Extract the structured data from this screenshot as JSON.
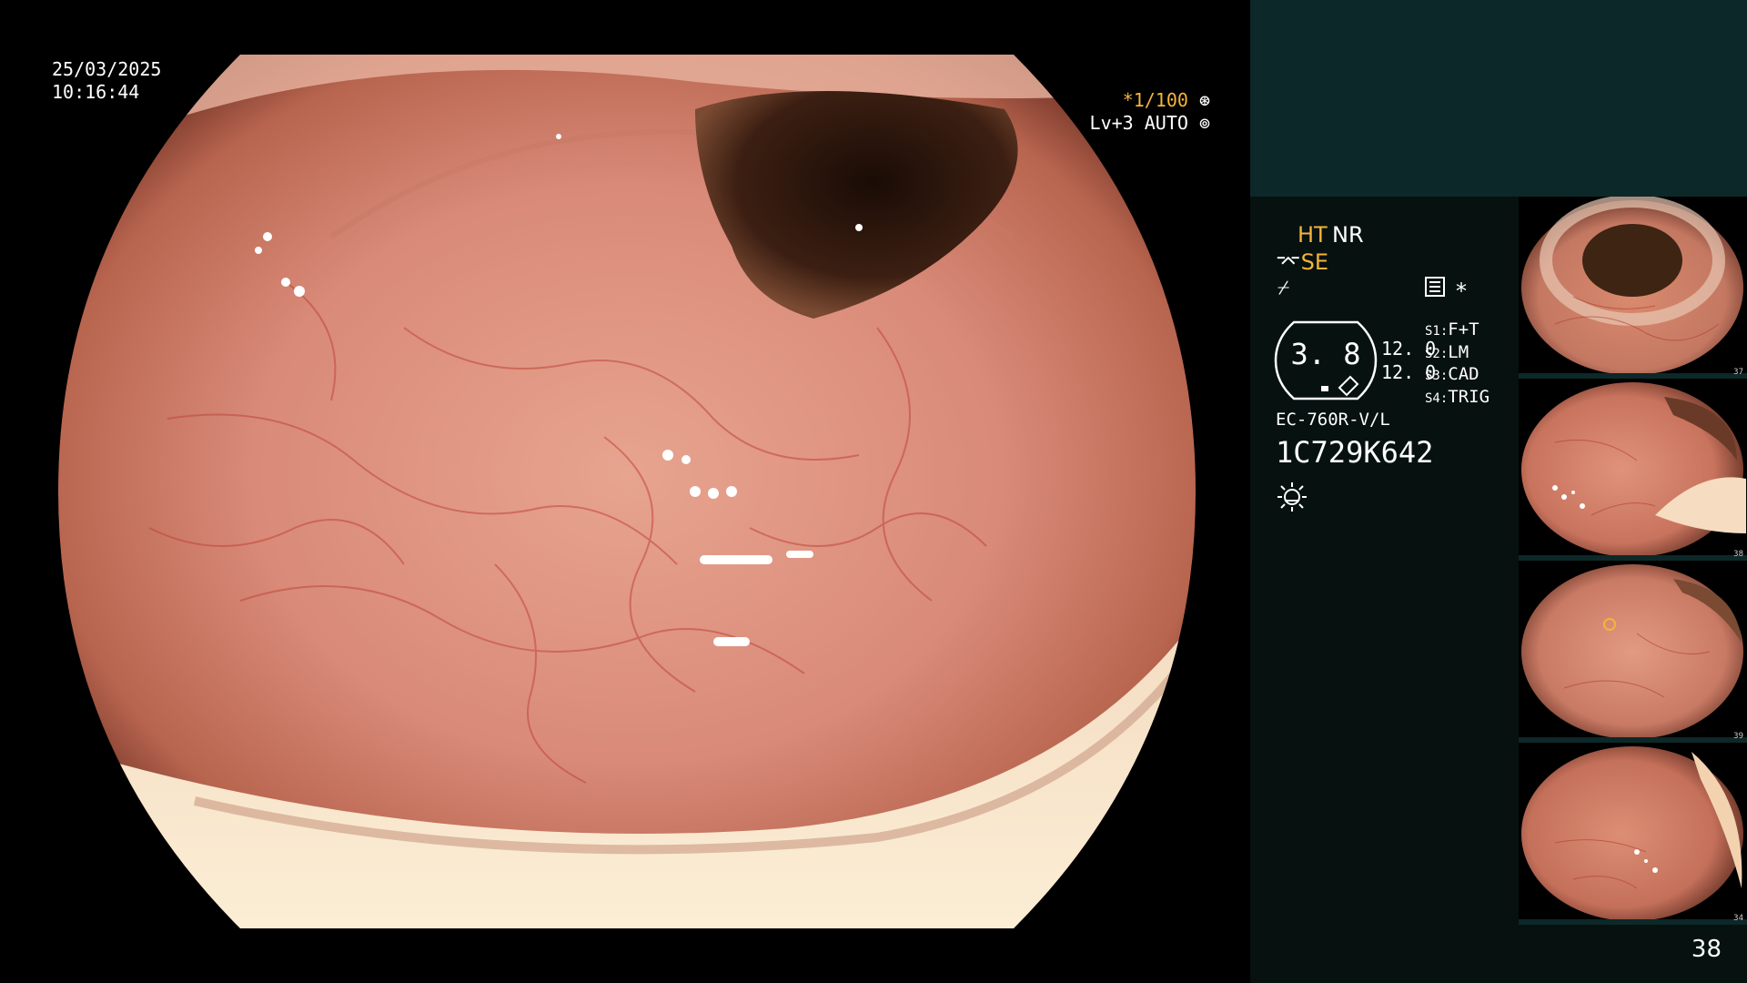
{
  "osd": {
    "date": "25/03/2025",
    "time": "10:16:44",
    "shutter": "*1/100",
    "shutter_icon": "aperture-icon",
    "iris": "Lv+3 AUTO",
    "iris_icon": "iris-auto-icon"
  },
  "panel": {
    "mode_ht": "HT",
    "mode_nr": "NR",
    "se_label": "SE",
    "se_prefix_icon": "scope-tip-icon",
    "f_symbol": "⌿",
    "menu_icon": "panel-icon",
    "star": "*",
    "gauge_value": "3. 8",
    "gauge_value_a": "12. 0",
    "gauge_value_b": "12. 0",
    "switches": [
      {
        "key": "S1:",
        "value": "F+T"
      },
      {
        "key": "S2:",
        "value": "LM"
      },
      {
        "key": "S3:",
        "value": "CAD"
      },
      {
        "key": "S4:",
        "value": "TRIG"
      }
    ],
    "scope_model": "EC-760R-V/L",
    "scope_serial": "1C729K642",
    "light_icon": "light-source-icon"
  },
  "thumbnails": [
    {
      "number": "37"
    },
    {
      "number": "38"
    },
    {
      "number": "39"
    },
    {
      "number": "34"
    }
  ],
  "page_number": "38",
  "colors": {
    "amber": "#f5b43a",
    "panel_bg": "#061110",
    "panel_top": "#0d2828",
    "mucosa": "#d98a78"
  }
}
